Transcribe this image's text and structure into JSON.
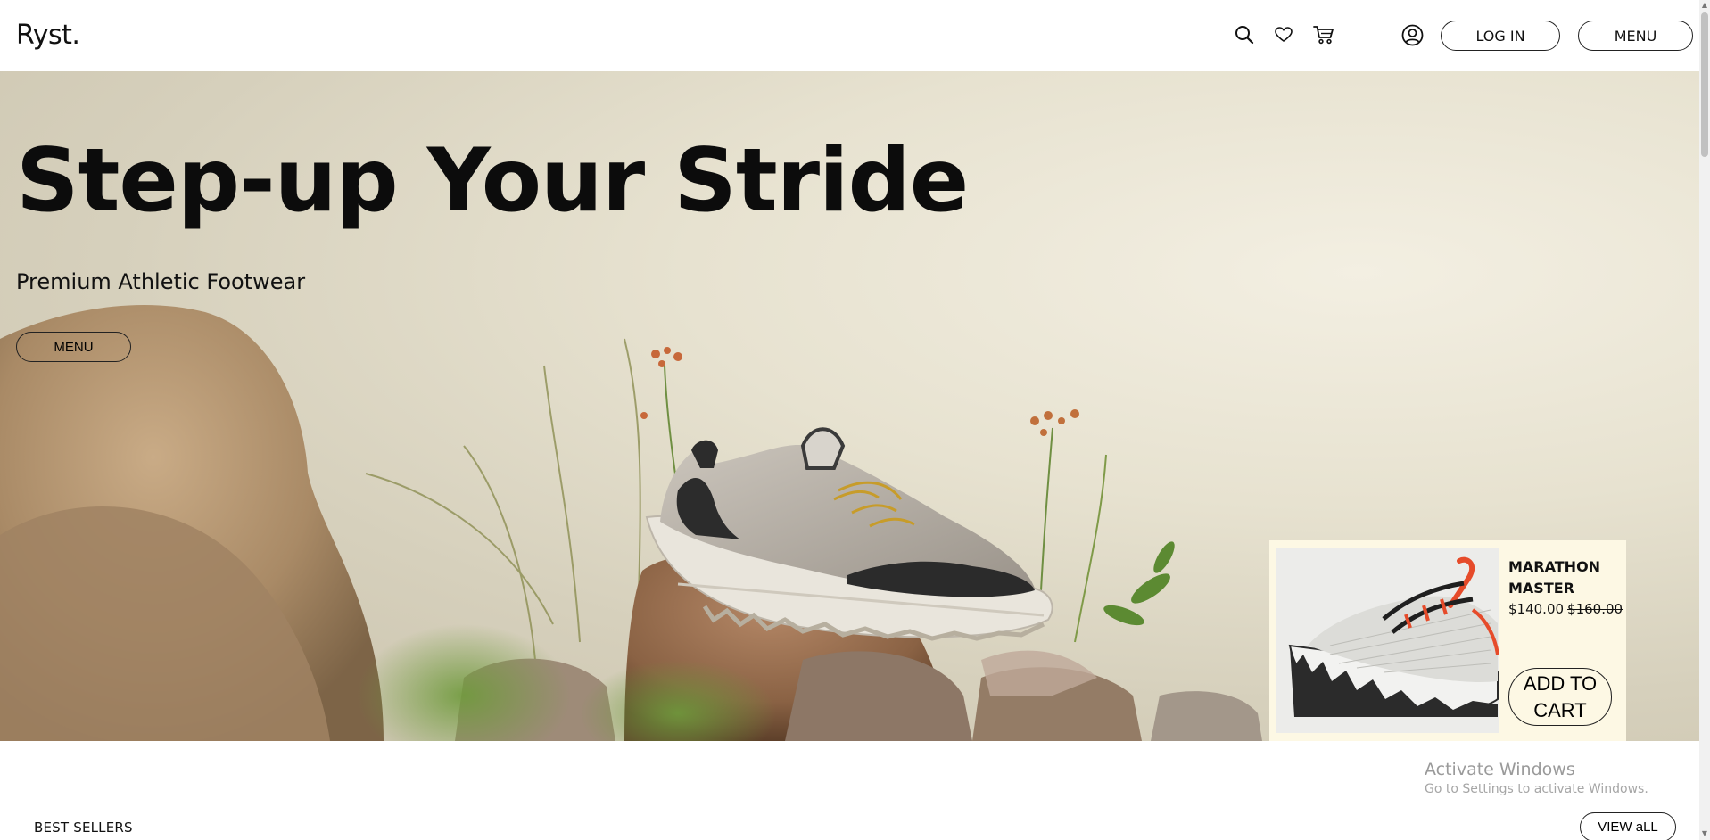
{
  "header": {
    "logo": "Ryst.",
    "icons": [
      "search-icon",
      "heart-icon",
      "cart-icon",
      "user-icon"
    ],
    "login_label": "LOG IN",
    "menu_label": "MENU"
  },
  "hero": {
    "title": "Step-up Your Stride",
    "subtitle": "Premium Athletic Footwear",
    "button_label": "MENU"
  },
  "product_card": {
    "name": "MARATHON MASTER",
    "price": "$140.00",
    "old_price": "$160.00",
    "cta_label": "ADD TO CART",
    "background": "#fdf8e4"
  },
  "best_sellers": {
    "heading": "BEST SELLERS",
    "view_all_label": "VIEW aLL"
  },
  "watermark": {
    "title": "Activate Windows",
    "subtitle": "Go to Settings to activate Windows."
  }
}
